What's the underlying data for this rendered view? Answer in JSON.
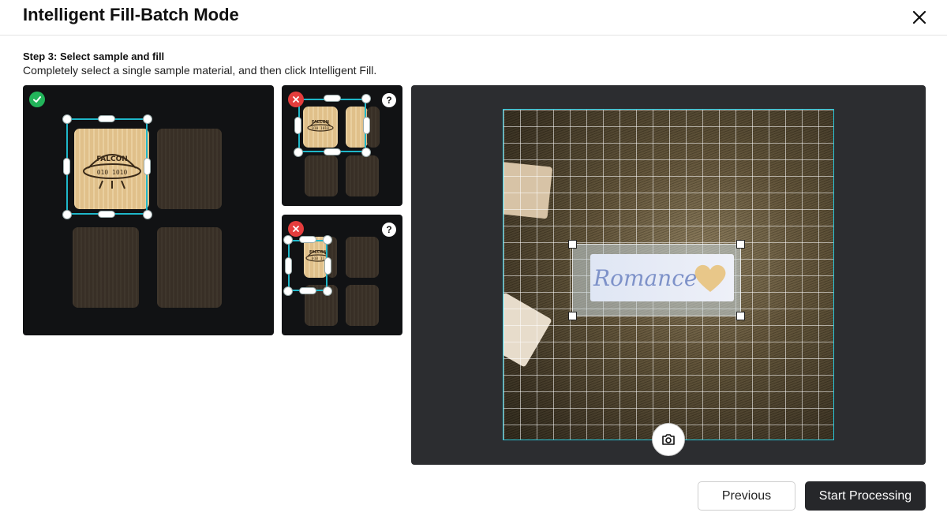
{
  "dialog": {
    "title": "Intelligent Fill-Batch Mode"
  },
  "step": {
    "title": "Step 3: Select sample and fill",
    "description": "Completely select a single sample material, and then click Intelligent Fill."
  },
  "samples": [
    {
      "status": "selected",
      "status_icon": "check-icon",
      "engraving_text": "FALCON",
      "engraving_code": "010 1010"
    },
    {
      "status": "error",
      "status_icon": "x-icon",
      "help": "?",
      "engraving_text": "FALCON",
      "engraving_code": "010 1010"
    },
    {
      "status": "error",
      "status_icon": "x-icon",
      "help": "?",
      "engraving_text": "FALCON",
      "engraving_code": "010 11"
    }
  ],
  "preview": {
    "object_text": "Romance",
    "camera_icon": "camera-icon"
  },
  "buttons": {
    "previous": "Previous",
    "start": "Start Processing"
  },
  "colors": {
    "selection": "#1fb7c9",
    "ok": "#22b45a",
    "error": "#e53d3d",
    "primary_button": "#26272a"
  }
}
